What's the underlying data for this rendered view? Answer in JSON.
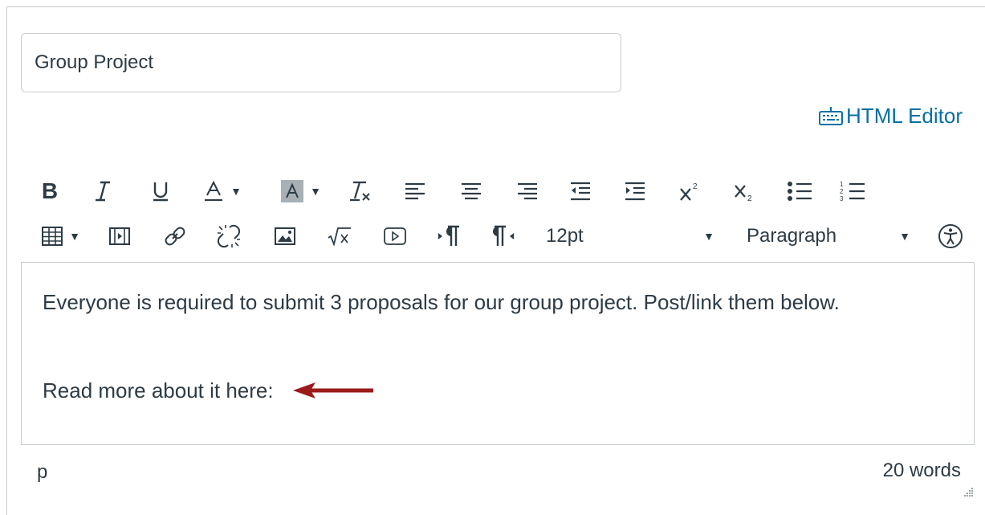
{
  "title_field": {
    "value": "Group Project"
  },
  "html_editor_link": {
    "label": "HTML Editor",
    "icon": "keyboard-icon",
    "color": "#0770a3"
  },
  "toolbar": {
    "row1": [
      "bold-icon",
      "italic-icon",
      "underline-icon",
      "text-color-icon",
      "background-color-icon",
      "clear-formatting-icon",
      "align-left-icon",
      "align-center-icon",
      "align-right-icon",
      "outdent-icon",
      "indent-icon",
      "superscript-icon",
      "subscript-icon",
      "bulleted-list-icon",
      "numbered-list-icon"
    ],
    "row2": [
      "table-icon",
      "media-icon",
      "link-icon",
      "unlink-icon",
      "image-icon",
      "equation-icon",
      "embed-media-icon",
      "ltr-paragraph-icon",
      "rtl-paragraph-icon",
      "accessibility-icon"
    ],
    "font_size": "12pt",
    "block_format": "Paragraph"
  },
  "content": {
    "paragraph1": "Everyone is required to submit 3 proposals for our group project. Post/link them below.",
    "paragraph2": "Read more about it here:",
    "arrow_color": "#9b1b1b"
  },
  "status_bar": {
    "path": "p",
    "word_count": "20 words"
  }
}
